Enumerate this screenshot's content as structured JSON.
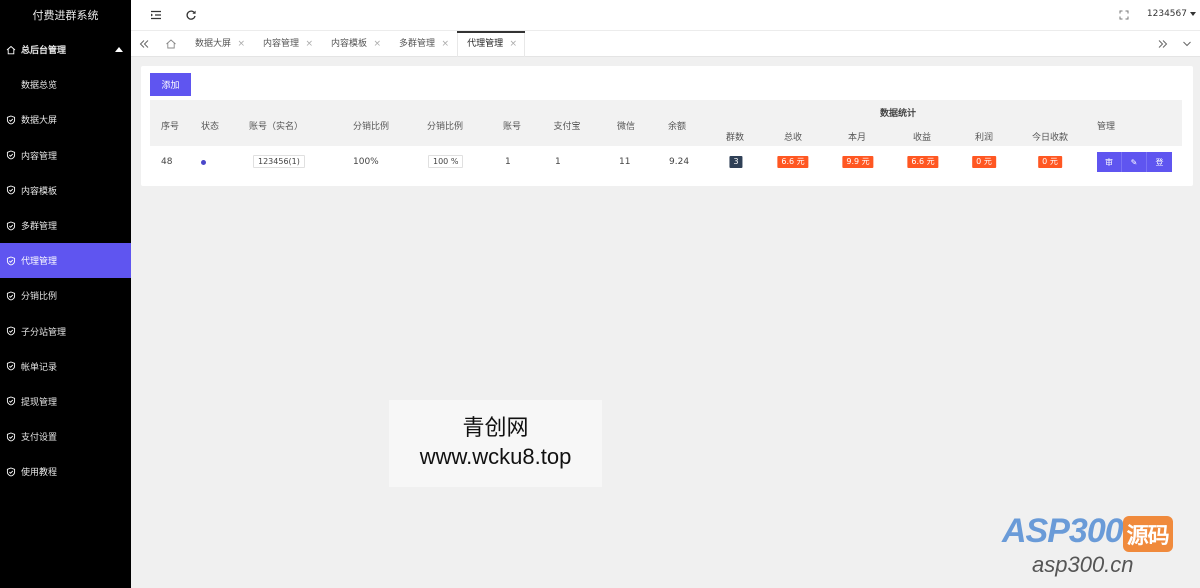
{
  "sidebar": {
    "brand": "付费进群系统",
    "items": [
      {
        "label": "总后台管理",
        "icon": "home-icon",
        "type": "group"
      },
      {
        "label": "数据总览",
        "type": "sub"
      },
      {
        "label": "数据大屏",
        "icon": "shield-check-icon"
      },
      {
        "label": "内容管理",
        "icon": "shield-check-icon"
      },
      {
        "label": "内容模板",
        "icon": "shield-check-icon"
      },
      {
        "label": "多群管理",
        "icon": "shield-check-icon"
      },
      {
        "label": "代理管理",
        "icon": "shield-check-icon",
        "active": true
      },
      {
        "label": "分销比例",
        "icon": "shield-check-icon"
      },
      {
        "label": "子分站管理",
        "icon": "shield-check-icon"
      },
      {
        "label": "帐单记录",
        "icon": "shield-check-icon"
      },
      {
        "label": "提现管理",
        "icon": "shield-check-icon"
      },
      {
        "label": "支付设置",
        "icon": "shield-check-icon"
      },
      {
        "label": "使用教程",
        "icon": "shield-check-icon"
      }
    ]
  },
  "topbar": {
    "menu_icon": "menu-fold-icon",
    "refresh_icon": "refresh-icon",
    "fullscreen_icon": "fullscreen-icon",
    "username": "1234567"
  },
  "tabs": [
    {
      "label": "数据大屏"
    },
    {
      "label": "内容管理"
    },
    {
      "label": "内容模板"
    },
    {
      "label": "多群管理"
    },
    {
      "label": "代理管理",
      "active": true
    }
  ],
  "toolbar": {
    "add_label": "添加"
  },
  "table": {
    "headers": {
      "index": "序号",
      "status": "状态",
      "account": "账号（实名）",
      "ratio1": "分销比例",
      "ratio2": "分销比例",
      "acct": "账号",
      "alipay": "支付宝",
      "wechat": "微信",
      "balance": "余额",
      "stats_group": "数据统计",
      "groups": "群数",
      "total": "总收",
      "month": "本月",
      "income": "收益",
      "profit": "利润",
      "today": "今日收款",
      "manage": "管理"
    },
    "rows": [
      {
        "index": "48",
        "account": "123456(1)",
        "ratio1": "100%",
        "ratio2": "100 %",
        "acct": "1",
        "alipay": "1",
        "wechat": "11",
        "balance": "9.24",
        "groups": "3",
        "total": "6.6 元",
        "month": "9.9 元",
        "income": "6.6 元",
        "profit": "0 元",
        "today": "0 元",
        "actions": [
          "审",
          "✎",
          "登"
        ]
      }
    ]
  },
  "colors": {
    "sidebar_bg": "#000000",
    "accent": "#5f55f0",
    "badge": "#ff5722",
    "badge_dark": "#2f4056"
  },
  "watermark": {
    "line1": "青创网",
    "line2": "www.wcku8.top"
  },
  "logo": {
    "brand": "ASP300",
    "brand_suffix": "源码",
    "site": "asp300.cn"
  }
}
